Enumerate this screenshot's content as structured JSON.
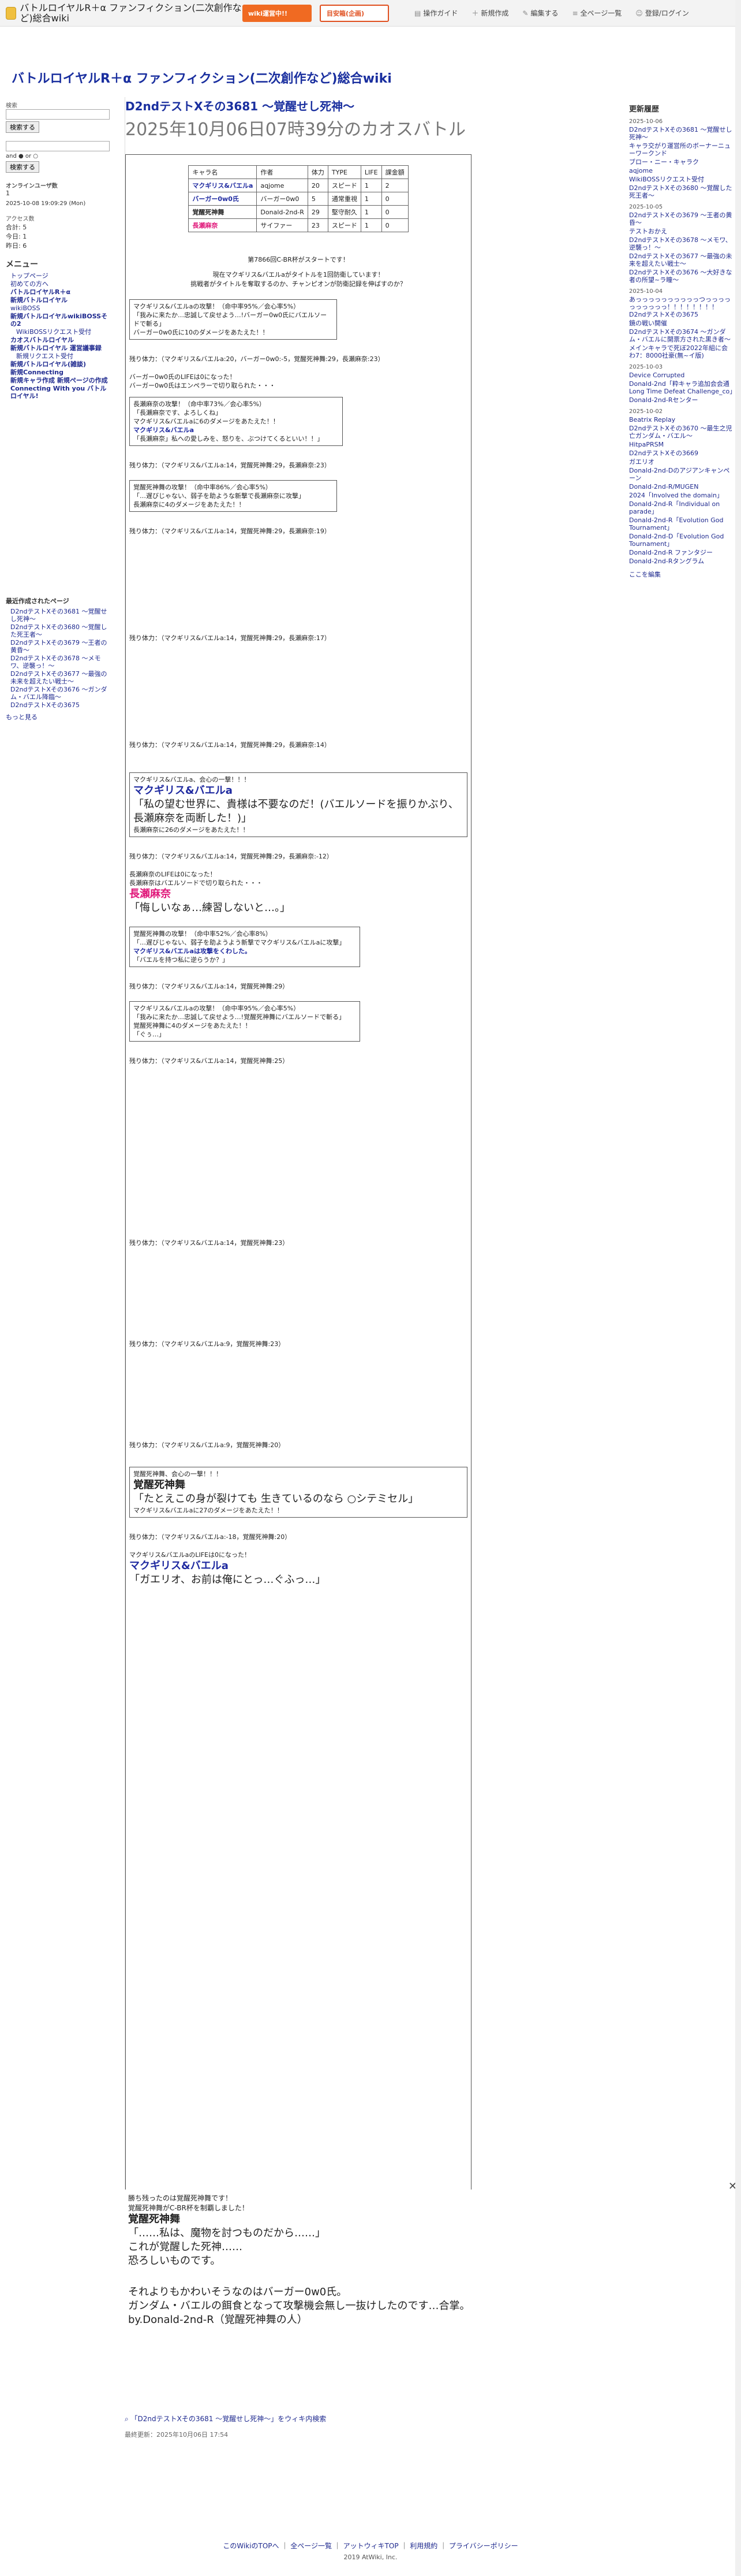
{
  "header": {
    "site_name": "バトルロイヤルR＋α ファンフィクション(二次創作など)総合wiki",
    "ad1": "wiki運営中!!",
    "ad2": "目安箱(企画)",
    "nav": [
      "操作ガイド",
      "新規作成",
      "編集する",
      "全ページ一覧",
      "登録/ログイン"
    ]
  },
  "site_title": "バトルロイヤルR＋α ファンフィクション(二次創作など)総合wiki",
  "left": {
    "search_label": "検索",
    "search_button": "検索する",
    "and_or": "and ● or ○",
    "tag_search_button": "検索する",
    "online_label": "オンラインユーザ数",
    "online_count": "1",
    "last_updated": "2025-10-08 19:09:29 (Mon)",
    "access_label": "アクセス数",
    "access": [
      "合計: 5",
      "今日: 1",
      "昨日: 6"
    ],
    "menu_title": "メニュー",
    "menu": [
      {
        "t": "トップページ",
        "b": false
      },
      {
        "t": "初めての方へ",
        "b": false
      },
      {
        "t": "バトルロイヤルR＋α",
        "b": true
      },
      {
        "t": "新規バトルロイヤル",
        "b": true
      },
      {
        "t": "wikiBOSS",
        "b": false
      },
      {
        "t": "新規バトルロイヤルwikiBOSSその2",
        "b": true
      },
      {
        "t": "WikiBOSSリクエスト受付",
        "b": false
      },
      {
        "t": "カオスバトルロイヤル",
        "b": true
      },
      {
        "t": "新規バトルロイヤル 運営議事録",
        "b": true
      },
      {
        "t": "新規リクエスト受付",
        "b": false
      },
      {
        "t": "新規バトルロイヤル(雑談)",
        "b": true
      },
      {
        "t": "新規Connecting",
        "b": true
      },
      {
        "t": "新規キャラ作成 新規ページの作成",
        "b": true
      },
      {
        "t": "Connecting With you バトルロイヤル!",
        "b": true
      }
    ],
    "recent_title": "最近作成されたページ",
    "recent": [
      "D2ndテストXその3681 〜覚醒せし死神〜",
      "D2ndテストXその3680 〜覚醒した死王者〜",
      "D2ndテストXその3679 〜王者の黄昏〜",
      "D2ndテストXその3678 〜メモワ、逆襲っ！〜",
      "D2ndテストXその3677 〜最強の未来を超えたい戦士〜",
      "D2ndテストXその3676 〜ガンダム・バエル降臨〜",
      "D2ndテストXその3675"
    ],
    "more": "もっと見る"
  },
  "main": {
    "title": "D2ndテストXその3681 〜覚醒せし死神〜",
    "subtitle": "2025年10月06日07時39分のカオスバトル",
    "table_headers": [
      "キャラ名",
      "作者",
      "体力",
      "TYPE",
      "LIFE",
      "課金額"
    ],
    "table_rows": [
      [
        "マクギリス&バエルa",
        "aqjome",
        "20",
        "スピード",
        "1",
        "2"
      ],
      [
        "バーガー0w0氏",
        "バーガー0w0",
        "5",
        "通常重視",
        "1",
        "0"
      ],
      [
        "覚醒死神舞",
        "Donald-2nd-R",
        "29",
        "堅守耐久",
        "1",
        "0"
      ],
      [
        "長瀬麻奈",
        "サイファー",
        "23",
        "スピード",
        "1",
        "0"
      ]
    ],
    "start_line": "第7866回C-BR杯がスタートです！",
    "start_line2": "現在マクギリス&バエルaがタイトルを1回防衛しています！",
    "start_line3": "挑戦者がタイトルを奪取するのか、チャンピオンが防衛記録を伸ばすのか？",
    "log": [
      "マクギリス&バエルaの攻撃！（命中率95%／会心率5%）",
      "「我みに来たか…忠誠して戻せよう…!バーガー0w0氏にバエルソードで斬る」",
      "バーガー0w0氏に10のダメージをあたえた！！",
      "残り体力：（マクギリス&バエルa:20，バーガー0w0:-5，覚醒死神舞:29，長瀬麻奈:23）",
      "バーガー0w0氏のLIFEは0になった！",
      "バーガー0w0氏はエンペラーで切り取られた・・・",
      "長瀬麻奈の攻撃！（命中率73%／会心率5%）",
      "「長瀬麻奈です、よろしくね」",
      "マクギリス&バエルaに6のダメージをあたえた！！",
      "マクギリス&バエルa",
      "「長瀬麻奈」私への愛しみを、怒りを、ぶつけてくるといい！！」",
      "残り体力：（マクギリス&バエルa:14，覚醒死神舞:29，長瀬麻奈:23）",
      "覚醒死神舞の攻撃！（命中率86%／会心率5%）",
      "「…遅びじゃない、弱子を助ような新撃で長瀬麻奈に攻撃」",
      "長瀬麻奈に4のダメージをあたえた！！",
      "残り体力：（マクギリス&バエルa:14，覚醒死神舞:29，長瀬麻奈:19）",
      "残り体力：（マクギリス&バエルa:14，覚醒死神舞:29，長瀬麻奈:17）",
      "残り体力：（マクギリス&バエルa:14，覚醒死神舞:29，長瀬麻奈:14）"
    ],
    "crit_name": "マクギリス&バエルa",
    "crit_attack": "マクギリス&バエルa、会心の一撃！！！",
    "crit_quote": "「私の望む世界に、貴様は不要なのだ！(バエルソードを振りかぶり、長瀬麻奈を両断した！)」",
    "crit_dmg": "長瀬麻奈に26のダメージをあたえた！！",
    "crit_hp": "残り体力：（マクギリス&バエルa:14，覚醒死神舞:29，長瀬麻奈:-12）",
    "ko1": "長瀬麻奈のLIFEは0になった！",
    "ko2": "長瀬麻奈はバエルソードで切り取られた・・・",
    "ko_name": "長瀬麻奈",
    "ko_quote": "「悔しいなぁ…練習しないと…。」",
    "more_log": [
      "覚醒死神舞の攻撃！（命中率52%／会心率8%）",
      "「…遅びじゃない、弱子を助ようよう新撃でマクギリス&バエルaに攻撃」",
      "マクギリス&バエルaは攻撃をくわした。",
      "「バエルを持つ私に逆らうか？」",
      "残り体力：（マクギリス&バエルa:14，覚醒死神舞:29）",
      "マクギリス&バエルaの攻撃！（命中率95%／会心率5%）",
      "「我みに来たか…忠誠して戻せよう…!覚醒死神舞にバエルソードで斬る」",
      "覚醒死神舞に4のダメージをあたえた！！",
      "「ぐぅ…」",
      "残り体力：（マクギリス&バエルa:14，覚醒死神舞:25）",
      "残り体力：（マクギリス&バエルa:14，覚醒死神舞:23）",
      "残り体力：（マクギリス&バエルa:9，覚醒死神舞:23）",
      "残り体力：（マクギリス&バエルa:9，覚醒死神舞:20）"
    ],
    "crit2_attack": "覚醒死神舞、会心の一撃！！！",
    "crit2_name": "覚醒死神舞",
    "crit2_quote": "「たとえこの身が裂けても 生きているのなら ○シテミセル」",
    "crit2_dmg": "マクギリス&バエルaに27のダメージをあたえた！！",
    "crit2_hp": "残り体力：（マクギリス&バエルa:-18，覚醒死神舞:20）",
    "final1": "マクギリス&バエルaのLIFEは0になった！",
    "final_name": "マクギリス&バエルa",
    "final_quote": "「ガエリオ、お前は俺にとっ…ぐふっ…」",
    "winner_line": "勝ち残ったのは覚醒死神舞です！",
    "winner_line2": "覚醒死神舞がC-BR杯を制覇しました！",
    "winner_name": "覚醒死神舞",
    "winner_quote1": "「……私は、魔物を討つものだから……」",
    "winner_quote2": "これが覚醒した死神……",
    "winner_quote3": "恐ろしいものです。",
    "epilogue1": "それよりもかわいそうなのはバーガー0w0氏。",
    "epilogue2": "ガンダム・バエルの餌食となって攻撃機会無し一抜けしたのです…合掌。",
    "author": "by.Donald-2nd-R（覚醒死神舞の人）",
    "wiki_link": "「D2ndテストXその3681 〜覚醒せし死神〜」をウィキ内検索",
    "updated": "最終更新：2025年10月06日 17:54"
  },
  "right": {
    "title": "更新履歴",
    "groups": [
      {
        "date": "2025-10-06",
        "items": [
          "D2ndテストXその3681 〜覚醒せし死神〜",
          "キャラ交がり運営所のボーナーニューワークンド",
          "ブロー・ニー・キャラク",
          "aqjome",
          "WikiBOSSリクエスト受付",
          "D2ndテストXその3680 〜覚醒した死王者〜"
        ]
      },
      {
        "date": "2025-10-05",
        "items": [
          "D2ndテストXその3679 〜王者の黄昏〜",
          "テストおかえ",
          "D2ndテストXその3678 〜メモワ、逆襲っ！〜",
          "D2ndテストXその3677 〜最強の未来を超えたい戦士〜",
          "D2ndテストXその3676 〜大好きな者の所望~ラ瞳〜"
        ]
      },
      {
        "date": "2025-10-04",
        "items": [
          "あっっっっっっっっっっつっっっっっっっっっっ！！！！！！！！D2ndテストXその3675",
          "鏡の戦い開催",
          "D2ndテストXその3674 〜ガンダム・バエルに開票方された黒き者〜",
          "メインキャラで死ぼ2022年組に会わ7：8000社豪(無~イ版)"
        ]
      },
      {
        "date": "2025-10-03",
        "items": [
          "Device Corrupted",
          "Donald-2nd「粋キャラ追加会会通 Long Time Defeat Challenge_co」",
          "Donald-2nd-Rセンター"
        ]
      },
      {
        "date": "2025-10-02",
        "items": [
          "Beatrix Replay",
          "D2ndテストXその3670 〜最生之児亡ガンダム・バエル〜",
          "HitpaPRSM",
          "D2ndテストXその3669",
          "ガエリオ",
          "Donald-2nd-Dのアジアンキャンペーン",
          "Donald-2nd-R/MUGEN",
          "2024「Involved the domain」",
          "Donald-2nd-R「Individual on parade」",
          "Donald-2nd-R「Evolution God Tournament」",
          "Donald-2nd-D「Evolution God Tournament」",
          "Donald-2nd-R ファンタジー",
          "Donald-2nd-Rタングラム"
        ]
      }
    ],
    "more": "ここを編集"
  },
  "footer": {
    "links": [
      "このWikiのTOPへ",
      "全ページ一覧",
      "アットウィキTOP",
      "利用規約",
      "プライバシーポリシー"
    ],
    "copyright": "2019 AtWiki, Inc."
  }
}
